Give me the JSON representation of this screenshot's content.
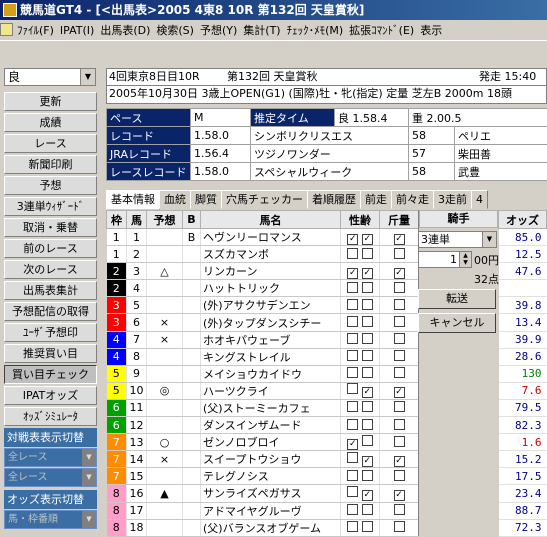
{
  "window": {
    "title": "競馬道GT4 - [<出馬表>2005 4東8 10R 第132回 天皇賞秋]"
  },
  "menu": [
    "ﾌｧｲﾙ(F)",
    "IPAT(I)",
    "出馬表(D)",
    "検索(S)",
    "予想(Y)",
    "集計(T)",
    "ﾁｪｯｸ･ﾒﾓ(M)",
    "拡張ｺﾏﾝﾄﾞ(E)",
    "表示"
  ],
  "sidebar": {
    "condition": "良",
    "buttons": [
      "更新",
      "成績",
      "レース",
      "新聞印刷",
      "予想",
      "3連単ｳｨｻﾞｰﾄﾞ",
      "取消・乗替",
      "前のレース",
      "次のレース",
      "出馬表集計",
      "予想配信の取得",
      "ﾕｰｻﾞ予想印",
      "推奨買い目",
      "買い目チェック",
      "IPATオッズ",
      "ｵｯｽﾞｼﾐｭﾚｰﾀ"
    ],
    "taisen_label": "対戦表表示切替",
    "taisen_sel1": "全レース",
    "taisen_sel2": "全レース",
    "odds_label": "オッズ表示切替",
    "odds_sel": "馬・枠番順"
  },
  "race": {
    "place": "4回東京8日目10R",
    "name": "第132回 天皇賞秋",
    "post_time": "発走 15:40",
    "detail": "2005年10月30日 3歳上OPEN(G1) (国際)牡・牝(指定) 定量 芝左B 2000m 18頭"
  },
  "info": {
    "pace_label": "ペース",
    "pace": "M",
    "est_label": "推定タイム",
    "est1": "良 1.58.4",
    "est2": "重 2.00.5",
    "rows": [
      {
        "label": "レコード",
        "time": "1.58.0",
        "horse": "シンボリクリスエス",
        "wt": "58",
        "jockey": "ペリエ"
      },
      {
        "label": "JRAレコード",
        "time": "1.56.4",
        "horse": "ツジノワンダー",
        "wt": "57",
        "jockey": "柴田善"
      },
      {
        "label": "レースレコード",
        "time": "1.58.0",
        "horse": "スペシャルウィーク",
        "wt": "58",
        "jockey": "武豊"
      }
    ]
  },
  "tabs": [
    "基本情報",
    "血統",
    "脚質",
    "穴馬チェッカー",
    "着順履歴",
    "前走",
    "前々走",
    "3走前",
    "4"
  ],
  "grid": {
    "headers": [
      "枠",
      "馬",
      "予想",
      "B",
      "馬名",
      "性齢",
      "斤量",
      "騎手",
      "オッズ"
    ],
    "rows": [
      {
        "waku": "1",
        "uma": "1",
        "mark": "",
        "b": "B",
        "name": "ヘヴンリーロマンス",
        "c1": true,
        "c2": true,
        "c3": true,
        "odds": "85.0",
        "oc": "#00008b"
      },
      {
        "waku": "1",
        "uma": "2",
        "mark": "",
        "b": "",
        "name": "スズカマンボ",
        "c1": false,
        "c2": false,
        "c3": false,
        "odds": "12.5",
        "oc": "#00008b"
      },
      {
        "waku": "2",
        "uma": "3",
        "mark": "△",
        "b": "",
        "name": "リンカーン",
        "c1": true,
        "c2": true,
        "c3": true,
        "odds": "47.6",
        "oc": "#00008b"
      },
      {
        "waku": "2",
        "uma": "4",
        "mark": "",
        "b": "",
        "name": "ハットトリック",
        "c1": false,
        "c2": false,
        "c3": false,
        "odds": "",
        "oc": "#00008b"
      },
      {
        "waku": "3",
        "uma": "5",
        "mark": "",
        "b": "",
        "name": "(外)アサクサデンエン",
        "c1": false,
        "c2": false,
        "c3": false,
        "odds": "39.8",
        "oc": "#00008b"
      },
      {
        "waku": "3",
        "uma": "6",
        "mark": "×",
        "b": "",
        "name": "(外)タップダンスシチー",
        "c1": false,
        "c2": false,
        "c3": false,
        "odds": "13.4",
        "oc": "#00008b"
      },
      {
        "waku": "4",
        "uma": "7",
        "mark": "×",
        "b": "",
        "name": "ホオキパウェーブ",
        "c1": false,
        "c2": false,
        "c3": false,
        "odds": "39.9",
        "oc": "#00008b"
      },
      {
        "waku": "4",
        "uma": "8",
        "mark": "",
        "b": "",
        "name": "キングストレイル",
        "c1": false,
        "c2": false,
        "c3": false,
        "odds": "28.6",
        "oc": "#00008b"
      },
      {
        "waku": "5",
        "uma": "9",
        "mark": "",
        "b": "",
        "name": "メイショウカイドウ",
        "c1": false,
        "c2": false,
        "c3": false,
        "odds": "130",
        "oc": "#008000"
      },
      {
        "waku": "5",
        "uma": "10",
        "mark": "◎",
        "b": "",
        "name": "ハーツクライ",
        "c1": false,
        "c2": true,
        "c3": true,
        "odds": "7.6",
        "oc": "#c00000"
      },
      {
        "waku": "6",
        "uma": "11",
        "mark": "",
        "b": "",
        "name": "(父)ストーミーカフェ",
        "c1": false,
        "c2": false,
        "c3": false,
        "odds": "79.5",
        "oc": "#00008b"
      },
      {
        "waku": "6",
        "uma": "12",
        "mark": "",
        "b": "",
        "name": "ダンスインザムード",
        "c1": false,
        "c2": false,
        "c3": false,
        "odds": "82.3",
        "oc": "#00008b"
      },
      {
        "waku": "7",
        "uma": "13",
        "mark": "○",
        "b": "",
        "name": "ゼンノロブロイ",
        "c1": true,
        "c2": false,
        "c3": false,
        "odds": "1.6",
        "oc": "#c00000"
      },
      {
        "waku": "7",
        "uma": "14",
        "mark": "×",
        "b": "",
        "name": "スイープトウショウ",
        "c1": false,
        "c2": true,
        "c3": true,
        "odds": "15.2",
        "oc": "#00008b"
      },
      {
        "waku": "7",
        "uma": "15",
        "mark": "",
        "b": "",
        "name": "テレグノシス",
        "c1": false,
        "c2": false,
        "c3": false,
        "odds": "17.5",
        "oc": "#00008b"
      },
      {
        "waku": "8",
        "uma": "16",
        "mark": "▲",
        "b": "",
        "name": "サンライズペガサス",
        "c1": false,
        "c2": true,
        "c3": true,
        "odds": "23.4",
        "oc": "#00008b"
      },
      {
        "waku": "8",
        "uma": "17",
        "mark": "",
        "b": "",
        "name": "アドマイヤグルーヴ",
        "c1": false,
        "c2": false,
        "c3": false,
        "odds": "88.7",
        "oc": "#00008b"
      },
      {
        "waku": "8",
        "uma": "18",
        "mark": "",
        "b": "",
        "name": "(父)バランスオブゲーム",
        "c1": false,
        "c2": false,
        "c3": false,
        "odds": "72.3",
        "oc": "#00008b"
      }
    ]
  },
  "kishu_panel": {
    "bet_type": "3連単",
    "amount": "1",
    "unit": "00円",
    "points": "32点",
    "transfer": "転送",
    "cancel": "キャンセル"
  },
  "waku_colors": {
    "1": [
      "#ffffff",
      "#000"
    ],
    "2": [
      "#000000",
      "#fff"
    ],
    "3": [
      "#ff0000",
      "#fff"
    ],
    "4": [
      "#0000ff",
      "#fff"
    ],
    "5": [
      "#ffff00",
      "#000"
    ],
    "6": [
      "#00a000",
      "#fff"
    ],
    "7": [
      "#ff8c00",
      "#fff"
    ],
    "8": [
      "#ff9ec8",
      "#000"
    ]
  }
}
